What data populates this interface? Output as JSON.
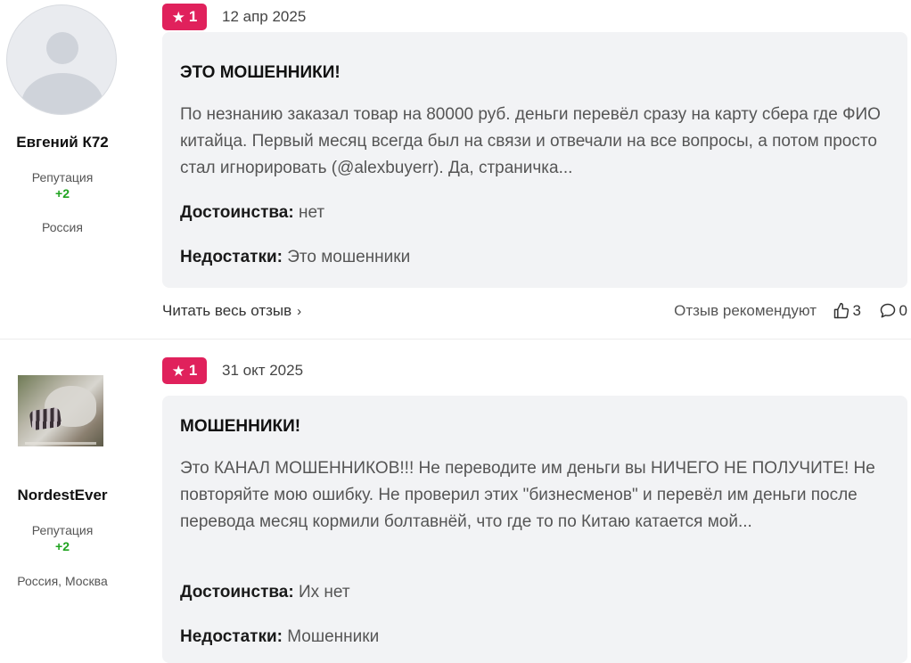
{
  "reviews": [
    {
      "author": {
        "name": "Евгений К72",
        "reputation_label": "Репутация",
        "reputation_value": "+2",
        "location": "Россия"
      },
      "rating": "1",
      "date": "12 апр 2025",
      "title": "ЭТО МОШЕННИКИ!",
      "text": "По незнанию заказал товар на 80000 руб. деньги перевёл сразу на карту сбера где ФИО китайца. Первый месяц всегда был на связи и отвечали на все вопросы, а потом просто стал игнорировать (@alexbuyerr). Да, страничка...",
      "pros_label": "Достоинства:",
      "pros": "нет",
      "cons_label": "Недостатки:",
      "cons": "Это мошенники",
      "read_more": "Читать весь отзыв",
      "recommend_label": "Отзыв рекомендуют",
      "likes": "3",
      "comments": "0"
    },
    {
      "author": {
        "name": "NordestEver",
        "reputation_label": "Репутация",
        "reputation_value": "+2",
        "location": "Россия, Москва"
      },
      "rating": "1",
      "date": "31 окт 2025",
      "title": "МОШЕННИКИ!",
      "text": "Это КАНАЛ МОШЕННИКОВ!!! Не переводите им деньги вы НИЧЕГО НЕ ПОЛУЧИТЕ! Не повторяйте мою ошибку. Не проверил этих \"бизнесменов\" и перевёл им деньги после перевода месяц кормили болтавнёй, что где то по Китаю катается мой...",
      "pros_label": "Достоинства:",
      "pros": "Их нет",
      "cons_label": "Недостатки:",
      "cons": "Мошенники"
    }
  ],
  "colors": {
    "rating_badge": "#e0215c",
    "reputation_positive": "#1ea31e",
    "card_background": "#f2f3f5"
  },
  "icons": {
    "rating": "star-icon",
    "read_more": "chevron-right-icon",
    "likes": "thumbs-up-icon",
    "comments": "comment-icon"
  }
}
